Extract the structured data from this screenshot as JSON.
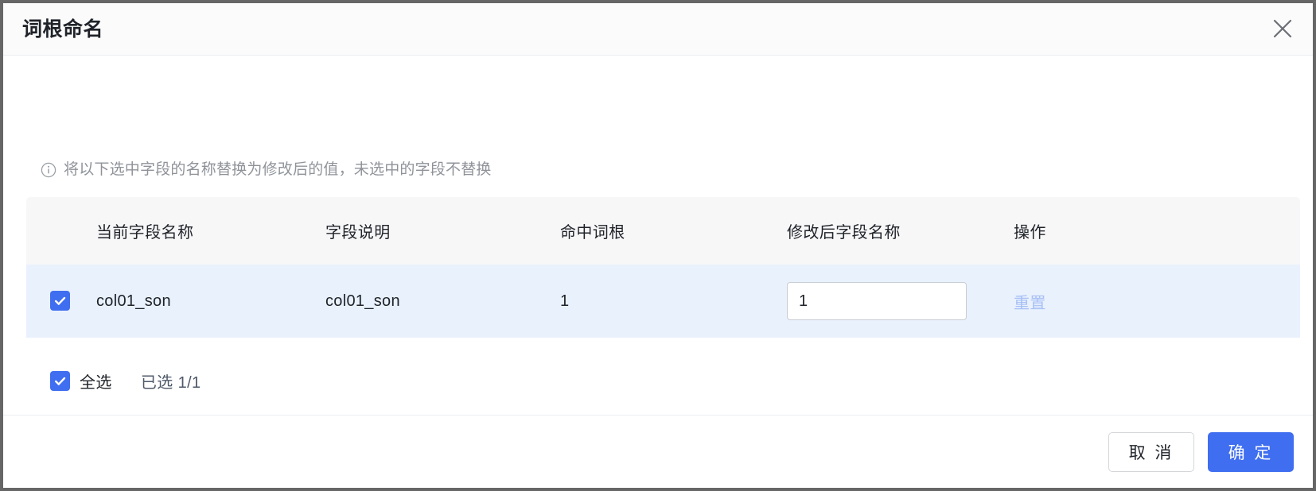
{
  "dialog": {
    "title": "词根命名",
    "close_icon": "close-icon",
    "info_icon": "info-circle-icon",
    "info_text": "将以下选中字段的名称替换为修改后的值，未选中的字段不替换"
  },
  "table": {
    "columns": [
      {
        "key": "checkbox",
        "label": ""
      },
      {
        "key": "current_name",
        "label": "当前字段名称"
      },
      {
        "key": "description",
        "label": "字段说明"
      },
      {
        "key": "hit_root",
        "label": "命中词根"
      },
      {
        "key": "new_name",
        "label": "修改后字段名称"
      },
      {
        "key": "operation",
        "label": "操作"
      }
    ],
    "rows": [
      {
        "checked": true,
        "current_name": "col01_son",
        "description": "col01_son",
        "hit_root": "1",
        "new_name_value": "1",
        "new_name_placeholder": "",
        "reset_label": "重置"
      }
    ]
  },
  "select_all": {
    "checked": true,
    "label": "全选",
    "count_label": "已选 1/1"
  },
  "footer": {
    "cancel_label": "取 消",
    "confirm_label": "确 定"
  },
  "colors": {
    "primary": "#3f6ef0",
    "selected_row_bg": "#e9f1fd",
    "header_bg": "#f7f7f8",
    "link_disabled": "#a7c0f5",
    "muted_text": "#8f9399"
  }
}
